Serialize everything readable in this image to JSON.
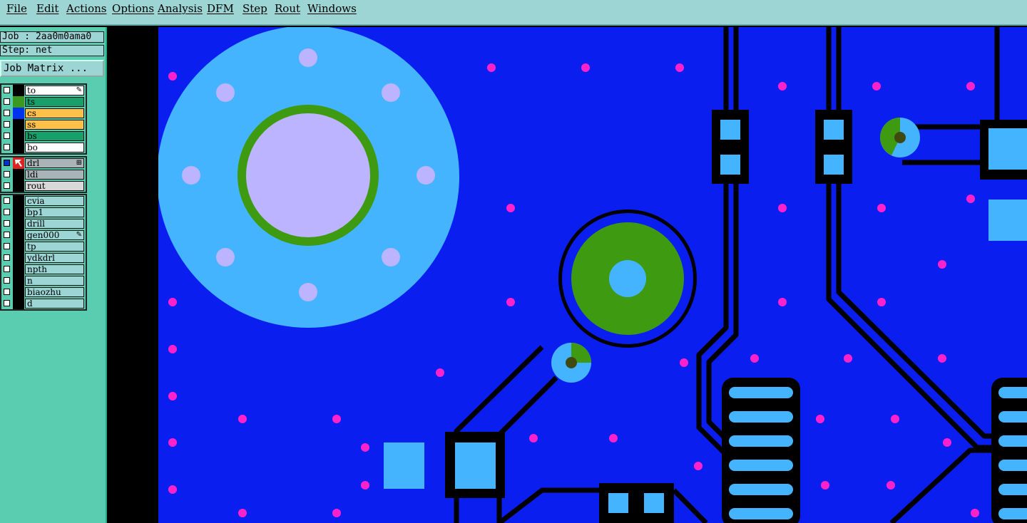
{
  "menu": [
    "File",
    "Edit",
    "Actions",
    "Options",
    "Analysis",
    "DFM",
    "Step",
    "Rout",
    "Windows"
  ],
  "job": {
    "label": "Job : 2aa0m0ama0",
    "step": "Step: net",
    "matrix_button": "Job Matrix ..."
  },
  "layer_groups": [
    {
      "layers": [
        {
          "name": "to",
          "color": "#ffffff",
          "swatch": "#000000",
          "checked": false,
          "mark": "✎"
        },
        {
          "name": "ts",
          "color": "#17a06a",
          "swatch": "#3a9a20",
          "checked": false,
          "mark": ""
        },
        {
          "name": "cs",
          "color": "#ffc04a",
          "swatch": "#0033ee",
          "checked": false,
          "mark": ""
        },
        {
          "name": "ss",
          "color": "#ffc04a",
          "swatch": "#000000",
          "checked": false,
          "mark": ""
        },
        {
          "name": "bs",
          "color": "#17a06a",
          "swatch": "#000000",
          "checked": false,
          "mark": ""
        },
        {
          "name": "bo",
          "color": "#ffffff",
          "swatch": "#000000",
          "checked": false,
          "mark": ""
        }
      ]
    },
    {
      "layers": [
        {
          "name": "drl",
          "color": "#a8b4b8",
          "swatch": "#dd2222",
          "checked": true,
          "mark": "⊞"
        },
        {
          "name": "ldi",
          "color": "#a8b4b8",
          "swatch": "#000000",
          "checked": false,
          "mark": ""
        },
        {
          "name": "rout",
          "color": "#d8d8d8",
          "swatch": "#000000",
          "checked": false,
          "mark": ""
        }
      ]
    },
    {
      "layers": [
        {
          "name": "cvia",
          "color": "#9dd4d4",
          "swatch": "#000000",
          "checked": false,
          "mark": ""
        },
        {
          "name": "bp1",
          "color": "#9dd4d4",
          "swatch": "#000000",
          "checked": false,
          "mark": ""
        },
        {
          "name": "drill",
          "color": "#9dd4d4",
          "swatch": "#000000",
          "checked": false,
          "mark": ""
        },
        {
          "name": "gen000",
          "color": "#9dd4d4",
          "swatch": "#000000",
          "checked": false,
          "mark": "✎"
        },
        {
          "name": "tp",
          "color": "#9dd4d4",
          "swatch": "#000000",
          "checked": false,
          "mark": ""
        },
        {
          "name": "ydkdrl",
          "color": "#9dd4d4",
          "swatch": "#000000",
          "checked": false,
          "mark": ""
        },
        {
          "name": "npth",
          "color": "#9dd4d4",
          "swatch": "#000000",
          "checked": false,
          "mark": ""
        },
        {
          "name": "n",
          "color": "#9dd4d4",
          "swatch": "#000000",
          "checked": false,
          "mark": ""
        },
        {
          "name": "biaozhu",
          "color": "#9dd4d4",
          "swatch": "#000000",
          "checked": false,
          "mark": ""
        },
        {
          "name": "d",
          "color": "#9dd4d4",
          "swatch": "#000000",
          "checked": false,
          "mark": ""
        }
      ]
    }
  ],
  "colors": {
    "board": "#0a1ef0",
    "pad": "#45b4ff",
    "copper": "#3e9a10",
    "trace": "#000000",
    "drill_dot": "#ff22cc",
    "hole": "#bcb4ff",
    "via_center": "#3e4a10"
  }
}
